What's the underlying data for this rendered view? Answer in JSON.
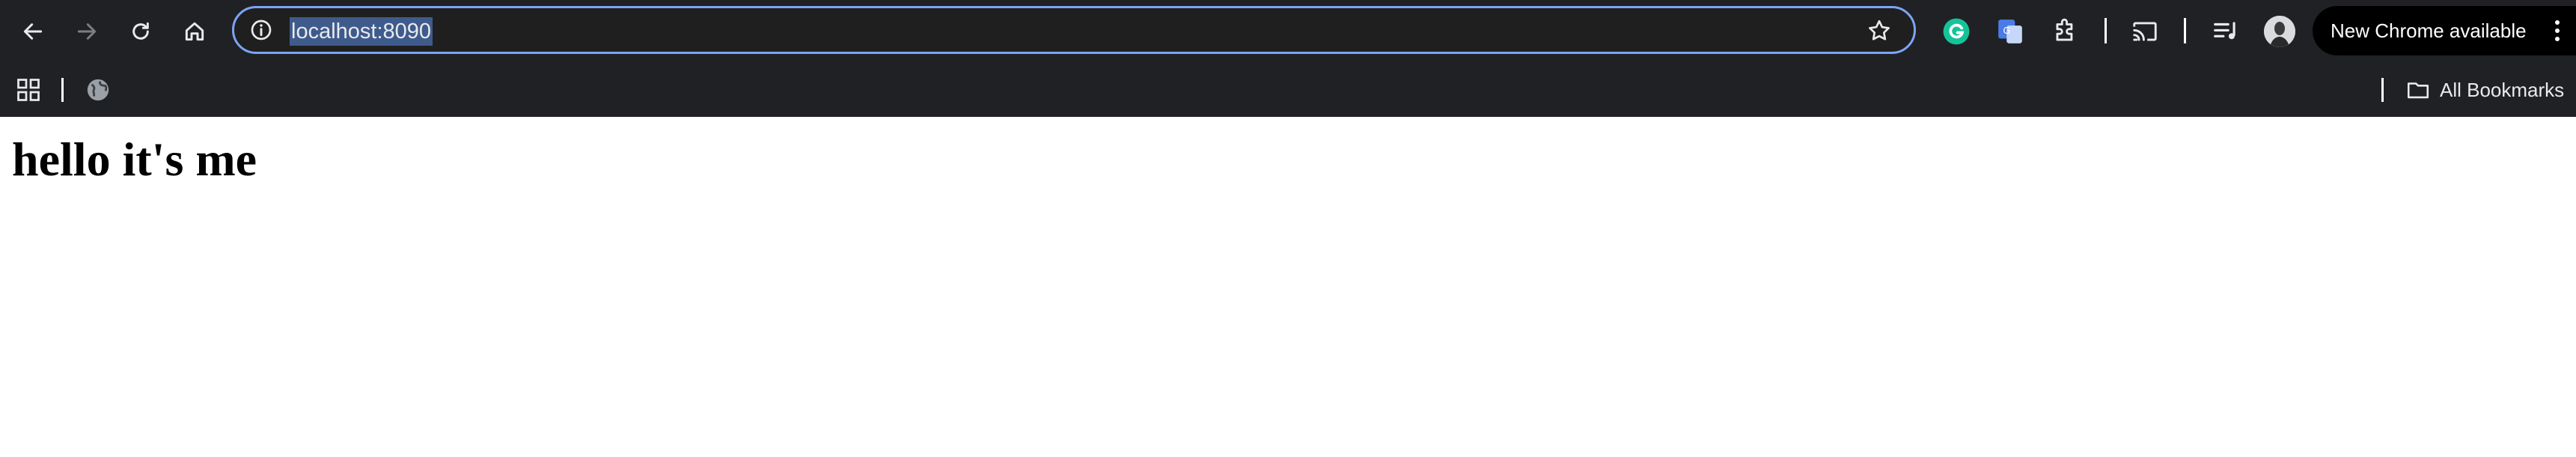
{
  "omnibox": {
    "url": "localhost:8090"
  },
  "toolbar": {
    "icons": [
      "back-icon",
      "forward-icon",
      "reload-icon",
      "home-icon",
      "site-info-icon",
      "bookmark-star-icon",
      "grammarly-icon",
      "google-translate-icon",
      "extensions-icon",
      "cast-icon",
      "reading-list-icon",
      "profile-avatar"
    ],
    "new_chrome_label": "New Chrome available"
  },
  "bookmarks_bar": {
    "all_bookmarks_label": "All Bookmarks"
  },
  "page": {
    "heading": "hello it's me"
  },
  "colors": {
    "toolbar_bg": "#202124",
    "omnibox_border": "#7ca4f5",
    "url_selection": "#3f5b8c",
    "grammarly_green": "#15c39a",
    "translate_blue": "#4a7ce8",
    "page_bg": "#ffffff"
  }
}
